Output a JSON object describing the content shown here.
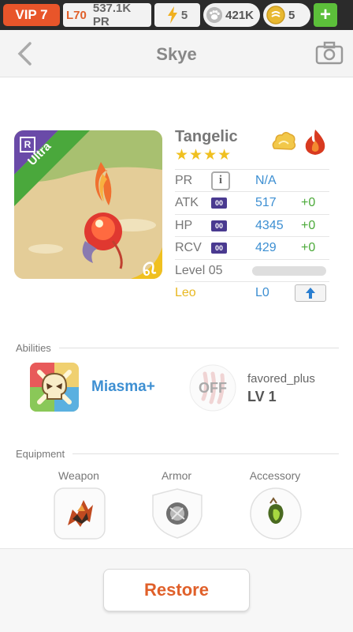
{
  "statusbar": {
    "vip": "VIP 7",
    "level": "L70",
    "pr": "537.1K PR",
    "energy": "5",
    "paws": "421K",
    "coins": "5",
    "add": "+"
  },
  "header": {
    "title": "Skye"
  },
  "character": {
    "name": "Tangelic",
    "stars": "★★★★",
    "rarity_letter": "R",
    "rarity": "Ultra",
    "stats": [
      {
        "label": "PR",
        "value": "N/A"
      },
      {
        "label": "ATK",
        "badge": "00",
        "value": "517",
        "bonus": "+0"
      },
      {
        "label": "HP",
        "badge": "00",
        "value": "4345",
        "bonus": "+0"
      },
      {
        "label": "RCV",
        "badge": "00",
        "value": "429",
        "bonus": "+0"
      }
    ],
    "level_label": "Level 05",
    "level_progress": 0.0,
    "zodiac_label": "Leo",
    "zodiac_level": "L0",
    "info_glyph": "i"
  },
  "abilities": {
    "heading": "Abilities",
    "primary_name": "Miasma+",
    "secondary_state": "OFF",
    "secondary_name": "favored_plus",
    "secondary_level": "LV 1"
  },
  "equipment": {
    "heading": "Equipment",
    "slots": [
      "Weapon",
      "Armor",
      "Accessory"
    ]
  },
  "footer": {
    "restore_label": "Restore"
  },
  "colors": {
    "accent": "#e0602a",
    "stat_value": "#3d8fd2",
    "bonus": "#4caa3a",
    "rarity_banner": "#4aa83c",
    "rarity_corner": "#6a4aa8"
  }
}
